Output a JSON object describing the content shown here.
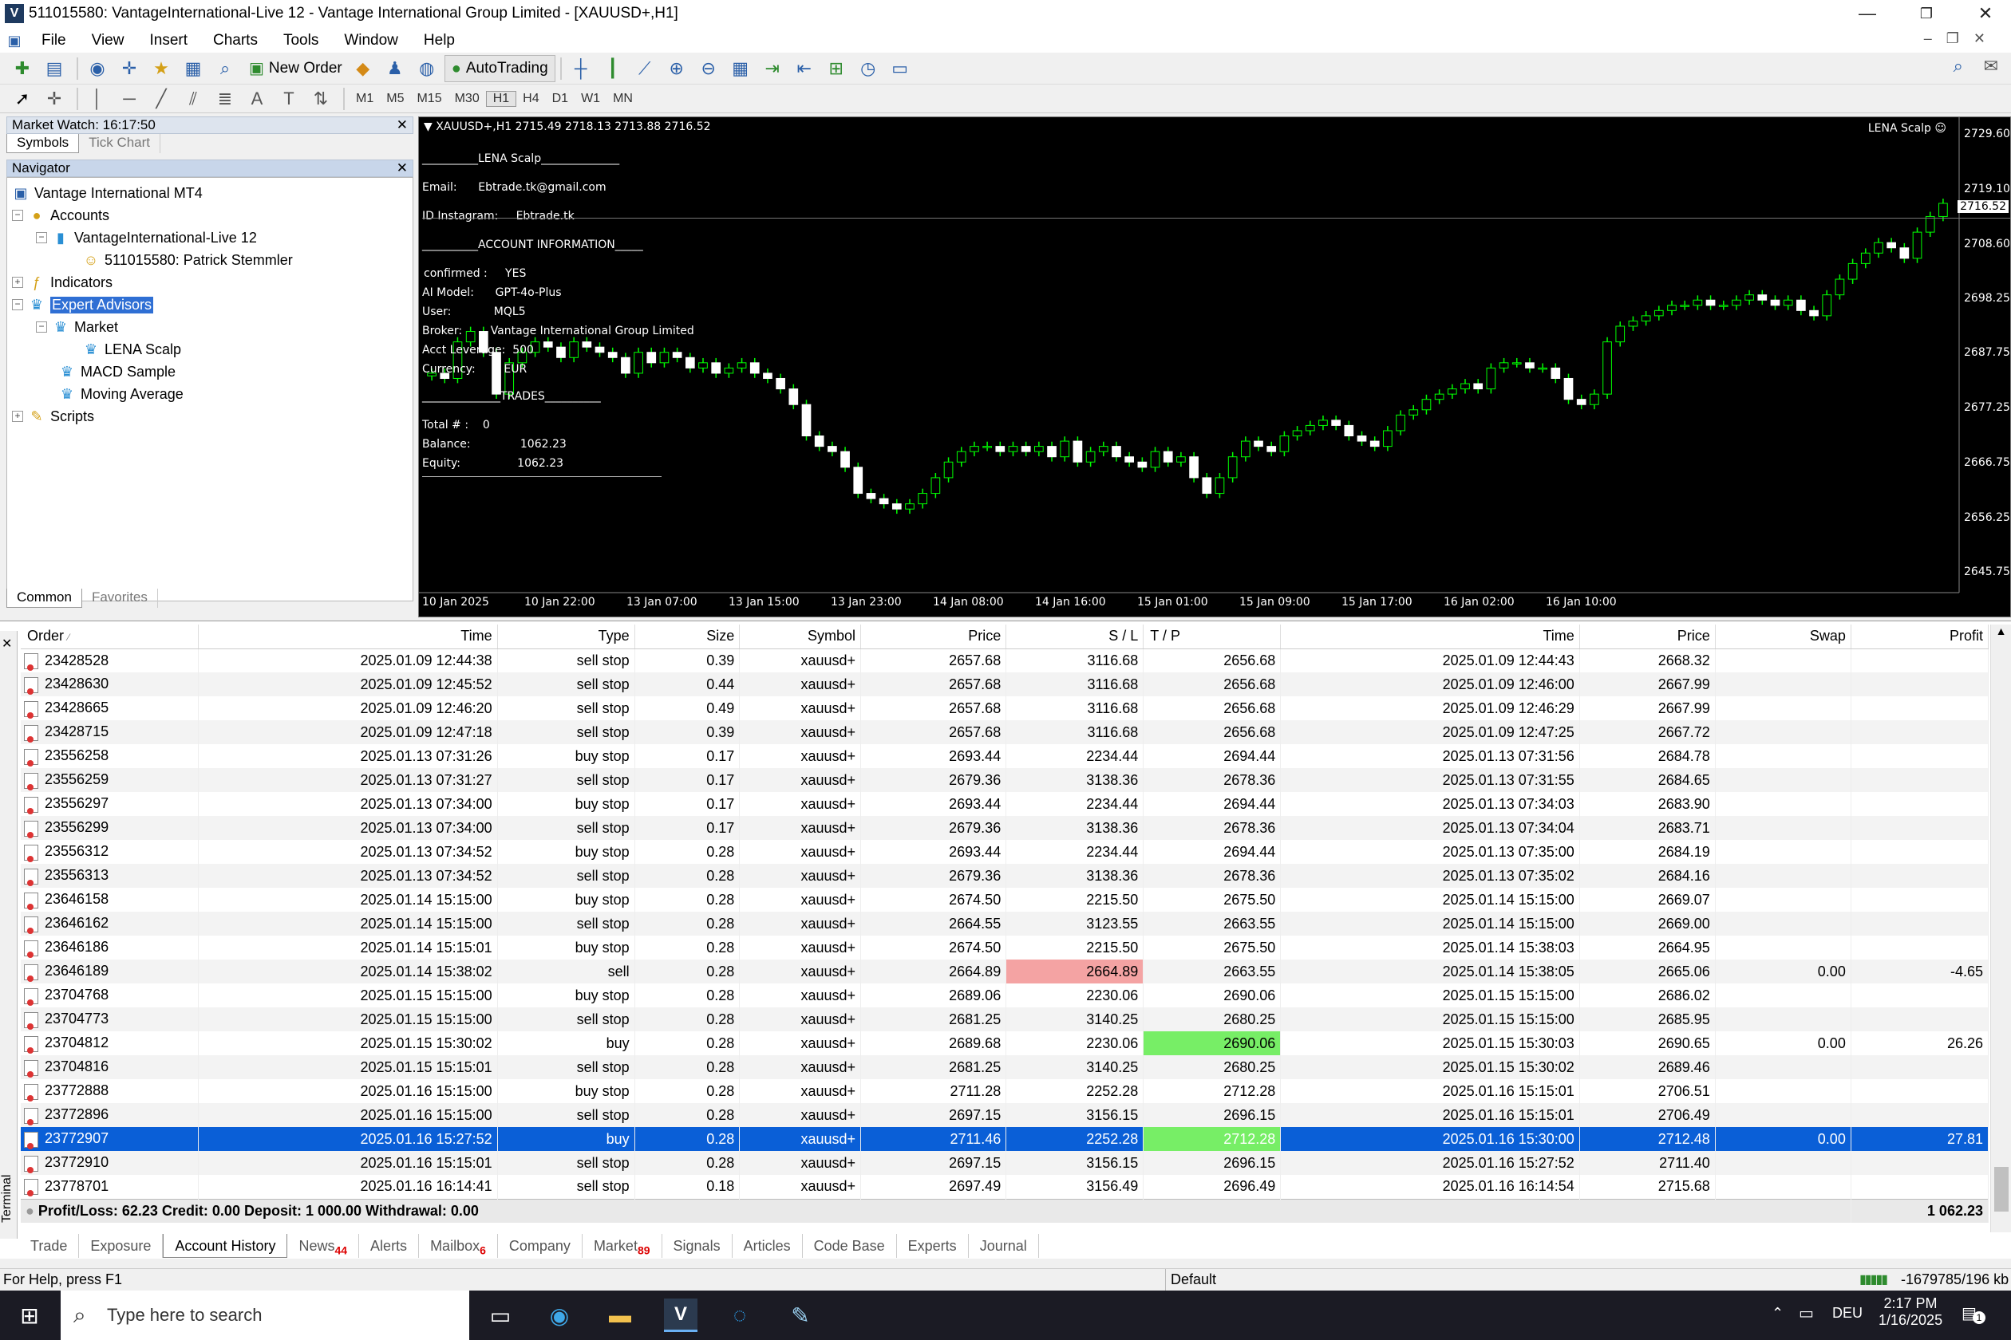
{
  "window": {
    "title": "511015580: VantageInternational-Live 12 - Vantage International Group Limited - [XAUUSD+,H1]",
    "app_icon": "V"
  },
  "menu": [
    "File",
    "View",
    "Insert",
    "Charts",
    "Tools",
    "Window",
    "Help"
  ],
  "toolbar": {
    "new_order": "New Order",
    "autotrading": "AutoTrading"
  },
  "timeframes": [
    "M1",
    "M5",
    "M15",
    "M30",
    "H1",
    "H4",
    "D1",
    "W1",
    "MN"
  ],
  "market_watch": {
    "title": "Market Watch: 16:17:50",
    "tabs": [
      "Symbols",
      "Tick Chart"
    ]
  },
  "navigator": {
    "title": "Navigator",
    "tree": {
      "root": "Vantage International MT4",
      "accounts": "Accounts",
      "server": "VantageInternational-Live 12",
      "account": "511015580: Patrick Stemmler",
      "indicators": "Indicators",
      "experts": "Expert Advisors",
      "market": "Market",
      "lena": "LENA Scalp",
      "macd": "MACD Sample",
      "ma": "Moving Average",
      "scripts": "Scripts"
    },
    "tabs": [
      "Common",
      "Favorites"
    ]
  },
  "chart": {
    "header": "XAUUSD+,H1  2715.49 2718.13 2713.88 2716.52",
    "ea_label": "LENA Scalp",
    "current_price": "2716.52",
    "overlay": {
      "title": "__________LENA Scalp______________",
      "email_label": "Email:",
      "email": "Ebtrade.tk@gmail.com",
      "ig_label": "ID Instagram:",
      "ig": "Ebtrade.tk",
      "acct_title": "__________ACCOUNT INFORMATION_____",
      "confirmed_label": "confirmed :",
      "confirmed": "YES",
      "aimodel_label": "AI Model:",
      "aimodel": "GPT-4o-Plus",
      "user_label": "User:",
      "user": "MQL5",
      "broker_label": "Broker:",
      "broker": "Vantage International Group Limited",
      "leverage_label": "Acct Leverage:",
      "leverage": "500",
      "currency_label": "Currency:",
      "currency": "EUR",
      "trades_title": "______________TRADES__________",
      "total_label": "Total # :",
      "total": "0",
      "balance_label": "Balance:",
      "balance": "1062.23",
      "equity_label": "Equity:",
      "equity": "1062.23"
    }
  },
  "chart_data": {
    "type": "candlestick",
    "symbol": "XAUUSD+",
    "timeframe": "H1",
    "y_ticks": [
      2729.6,
      2719.1,
      2708.6,
      2698.25,
      2687.75,
      2677.25,
      2666.75,
      2656.25,
      2645.75
    ],
    "x_ticks": [
      "10 Jan 2025",
      "10 Jan 22:00",
      "13 Jan 07:00",
      "13 Jan 15:00",
      "13 Jan 23:00",
      "14 Jan 08:00",
      "14 Jan 16:00",
      "15 Jan 01:00",
      "15 Jan 09:00",
      "15 Jan 17:00",
      "16 Jan 02:00",
      "16 Jan 10:00"
    ],
    "ylim": [
      2642,
      2733
    ],
    "closes": [
      2684,
      2683,
      2690,
      2692,
      2688,
      2680,
      2686,
      2688,
      2690,
      2689,
      2687,
      2690,
      2689,
      2688,
      2687,
      2684,
      2688,
      2686,
      2688,
      2687,
      2685,
      2686,
      2684,
      2685,
      2686,
      2684,
      2683,
      2681,
      2678,
      2672,
      2670,
      2669,
      2666,
      2661,
      2660,
      2659,
      2658,
      2659,
      2661,
      2664,
      2667,
      2669,
      2670,
      2670,
      2669,
      2670,
      2669,
      2670,
      2668,
      2671,
      2667,
      2669,
      2670,
      2668,
      2667,
      2666,
      2669,
      2667,
      2668,
      2664,
      2661,
      2664,
      2668,
      2671,
      2670,
      2669,
      2672,
      2673,
      2674,
      2675,
      2674,
      2672,
      2671,
      2670,
      2673,
      2676,
      2677,
      2679,
      2680,
      2681,
      2682,
      2681,
      2685,
      2686,
      2686,
      2685,
      2685,
      2683,
      2679,
      2678,
      2680,
      2690,
      2693,
      2694,
      2695,
      2696,
      2697,
      2697,
      2698,
      2697,
      2697,
      2698,
      2699,
      2698,
      2697,
      2698,
      2696,
      2695,
      2699,
      2702,
      2705,
      2707,
      2709,
      2708,
      2706,
      2711,
      2714,
      2716.52
    ]
  },
  "terminal": {
    "columns": [
      "Order",
      "Time",
      "Type",
      "Size",
      "Symbol",
      "Price",
      "S / L",
      "T / P",
      "Time",
      "Price",
      "Swap",
      "Profit"
    ],
    "rows": [
      [
        "23428528",
        "2025.01.09 12:44:38",
        "sell stop",
        "0.39",
        "xauusd+",
        "2657.68",
        "3116.68",
        "2656.68",
        "2025.01.09 12:44:43",
        "2668.32",
        "",
        ""
      ],
      [
        "23428630",
        "2025.01.09 12:45:52",
        "sell stop",
        "0.44",
        "xauusd+",
        "2657.68",
        "3116.68",
        "2656.68",
        "2025.01.09 12:46:00",
        "2667.99",
        "",
        ""
      ],
      [
        "23428665",
        "2025.01.09 12:46:20",
        "sell stop",
        "0.49",
        "xauusd+",
        "2657.68",
        "3116.68",
        "2656.68",
        "2025.01.09 12:46:29",
        "2667.99",
        "",
        ""
      ],
      [
        "23428715",
        "2025.01.09 12:47:18",
        "sell stop",
        "0.39",
        "xauusd+",
        "2657.68",
        "3116.68",
        "2656.68",
        "2025.01.09 12:47:25",
        "2667.72",
        "",
        ""
      ],
      [
        "23556258",
        "2025.01.13 07:31:26",
        "buy stop",
        "0.17",
        "xauusd+",
        "2693.44",
        "2234.44",
        "2694.44",
        "2025.01.13 07:31:56",
        "2684.78",
        "",
        ""
      ],
      [
        "23556259",
        "2025.01.13 07:31:27",
        "sell stop",
        "0.17",
        "xauusd+",
        "2679.36",
        "3138.36",
        "2678.36",
        "2025.01.13 07:31:55",
        "2684.65",
        "",
        ""
      ],
      [
        "23556297",
        "2025.01.13 07:34:00",
        "buy stop",
        "0.17",
        "xauusd+",
        "2693.44",
        "2234.44",
        "2694.44",
        "2025.01.13 07:34:03",
        "2683.90",
        "",
        ""
      ],
      [
        "23556299",
        "2025.01.13 07:34:00",
        "sell stop",
        "0.17",
        "xauusd+",
        "2679.36",
        "3138.36",
        "2678.36",
        "2025.01.13 07:34:04",
        "2683.71",
        "",
        ""
      ],
      [
        "23556312",
        "2025.01.13 07:34:52",
        "buy stop",
        "0.28",
        "xauusd+",
        "2693.44",
        "2234.44",
        "2694.44",
        "2025.01.13 07:35:00",
        "2684.19",
        "",
        ""
      ],
      [
        "23556313",
        "2025.01.13 07:34:52",
        "sell stop",
        "0.28",
        "xauusd+",
        "2679.36",
        "3138.36",
        "2678.36",
        "2025.01.13 07:35:02",
        "2684.16",
        "",
        ""
      ],
      [
        "23646158",
        "2025.01.14 15:15:00",
        "buy stop",
        "0.28",
        "xauusd+",
        "2674.50",
        "2215.50",
        "2675.50",
        "2025.01.14 15:15:00",
        "2669.07",
        "",
        ""
      ],
      [
        "23646162",
        "2025.01.14 15:15:00",
        "sell stop",
        "0.28",
        "xauusd+",
        "2664.55",
        "3123.55",
        "2663.55",
        "2025.01.14 15:15:00",
        "2669.00",
        "",
        ""
      ],
      [
        "23646186",
        "2025.01.14 15:15:01",
        "buy stop",
        "0.28",
        "xauusd+",
        "2674.50",
        "2215.50",
        "2675.50",
        "2025.01.14 15:38:03",
        "2664.95",
        "",
        ""
      ],
      [
        "23646189",
        "2025.01.14 15:38:02",
        "sell",
        "0.28",
        "xauusd+",
        "2664.89",
        "2664.89",
        "2663.55",
        "2025.01.14 15:38:05",
        "2665.06",
        "0.00",
        "-4.65"
      ],
      [
        "23704768",
        "2025.01.15 15:15:00",
        "buy stop",
        "0.28",
        "xauusd+",
        "2689.06",
        "2230.06",
        "2690.06",
        "2025.01.15 15:15:00",
        "2686.02",
        "",
        ""
      ],
      [
        "23704773",
        "2025.01.15 15:15:00",
        "sell stop",
        "0.28",
        "xauusd+",
        "2681.25",
        "3140.25",
        "2680.25",
        "2025.01.15 15:15:00",
        "2685.95",
        "",
        ""
      ],
      [
        "23704812",
        "2025.01.15 15:30:02",
        "buy",
        "0.28",
        "xauusd+",
        "2689.68",
        "2230.06",
        "2690.06",
        "2025.01.15 15:30:03",
        "2690.65",
        "0.00",
        "26.26"
      ],
      [
        "23704816",
        "2025.01.15 15:15:01",
        "sell stop",
        "0.28",
        "xauusd+",
        "2681.25",
        "3140.25",
        "2680.25",
        "2025.01.15 15:30:02",
        "2689.46",
        "",
        ""
      ],
      [
        "23772888",
        "2025.01.16 15:15:00",
        "buy stop",
        "0.28",
        "xauusd+",
        "2711.28",
        "2252.28",
        "2712.28",
        "2025.01.16 15:15:01",
        "2706.51",
        "",
        ""
      ],
      [
        "23772896",
        "2025.01.16 15:15:00",
        "sell stop",
        "0.28",
        "xauusd+",
        "2697.15",
        "3156.15",
        "2696.15",
        "2025.01.16 15:15:01",
        "2706.49",
        "",
        ""
      ],
      [
        "23772907",
        "2025.01.16 15:27:52",
        "buy",
        "0.28",
        "xauusd+",
        "2711.46",
        "2252.28",
        "2712.28",
        "2025.01.16 15:30:00",
        "2712.48",
        "0.00",
        "27.81"
      ],
      [
        "23772910",
        "2025.01.16 15:15:01",
        "sell stop",
        "0.28",
        "xauusd+",
        "2697.15",
        "3156.15",
        "2696.15",
        "2025.01.16 15:27:52",
        "2711.40",
        "",
        ""
      ],
      [
        "23778701",
        "2025.01.16 16:14:41",
        "sell stop",
        "0.18",
        "xauusd+",
        "2697.49",
        "3156.49",
        "2696.49",
        "2025.01.16 16:14:54",
        "2715.68",
        "",
        ""
      ]
    ],
    "summary": "Profit/Loss: 62.23  Credit: 0.00  Deposit: 1 000.00  Withdrawal: 0.00",
    "summary_total": "1 062.23",
    "side_label": "Terminal",
    "tabs": [
      {
        "label": "Trade",
        "count": ""
      },
      {
        "label": "Exposure",
        "count": ""
      },
      {
        "label": "Account History",
        "count": ""
      },
      {
        "label": "News",
        "count": "44"
      },
      {
        "label": "Alerts",
        "count": ""
      },
      {
        "label": "Mailbox",
        "count": "6"
      },
      {
        "label": "Company",
        "count": ""
      },
      {
        "label": "Market",
        "count": "89"
      },
      {
        "label": "Signals",
        "count": ""
      },
      {
        "label": "Articles",
        "count": ""
      },
      {
        "label": "Code Base",
        "count": ""
      },
      {
        "label": "Experts",
        "count": ""
      },
      {
        "label": "Journal",
        "count": ""
      }
    ]
  },
  "statusbar": {
    "help": "For Help, press F1",
    "profile": "Default",
    "traffic": "-1679785/196 kb"
  },
  "taskbar": {
    "search_placeholder": "Type here to search",
    "lang": "DEU",
    "time": "2:17 PM",
    "date": "1/16/2025",
    "notifications": "1"
  }
}
